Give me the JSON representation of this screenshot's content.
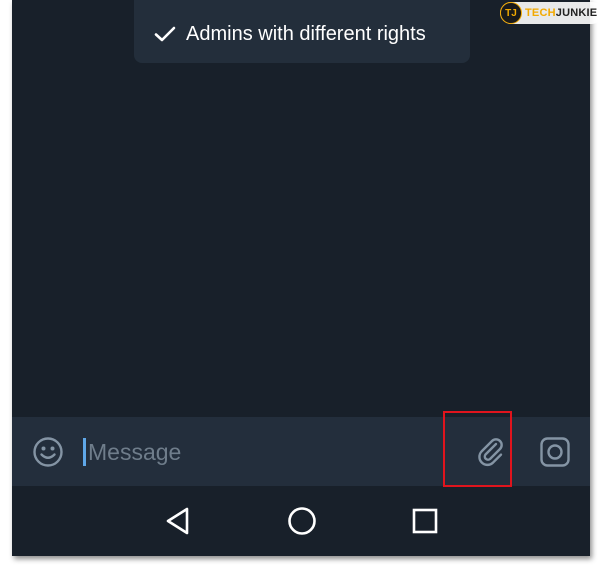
{
  "feature_tip": {
    "text": "Admins with different rights",
    "icon": "checkmark-icon"
  },
  "watermark": {
    "badge": "TJ",
    "brand_part1": "TECH",
    "brand_part2": "JUNKIE"
  },
  "input_bar": {
    "placeholder": "Message",
    "value": "",
    "left_icon": "emoji-icon",
    "attach_icon": "paperclip-icon",
    "right_icon": "camera-icon"
  },
  "nav_bar": {
    "icons": [
      "back-triangle-icon",
      "home-circle-icon",
      "recents-square-icon"
    ]
  },
  "colors": {
    "background": "#18202a",
    "panel": "#232e3c",
    "accent": "#5fa7e8",
    "highlight": "#e0141d"
  }
}
